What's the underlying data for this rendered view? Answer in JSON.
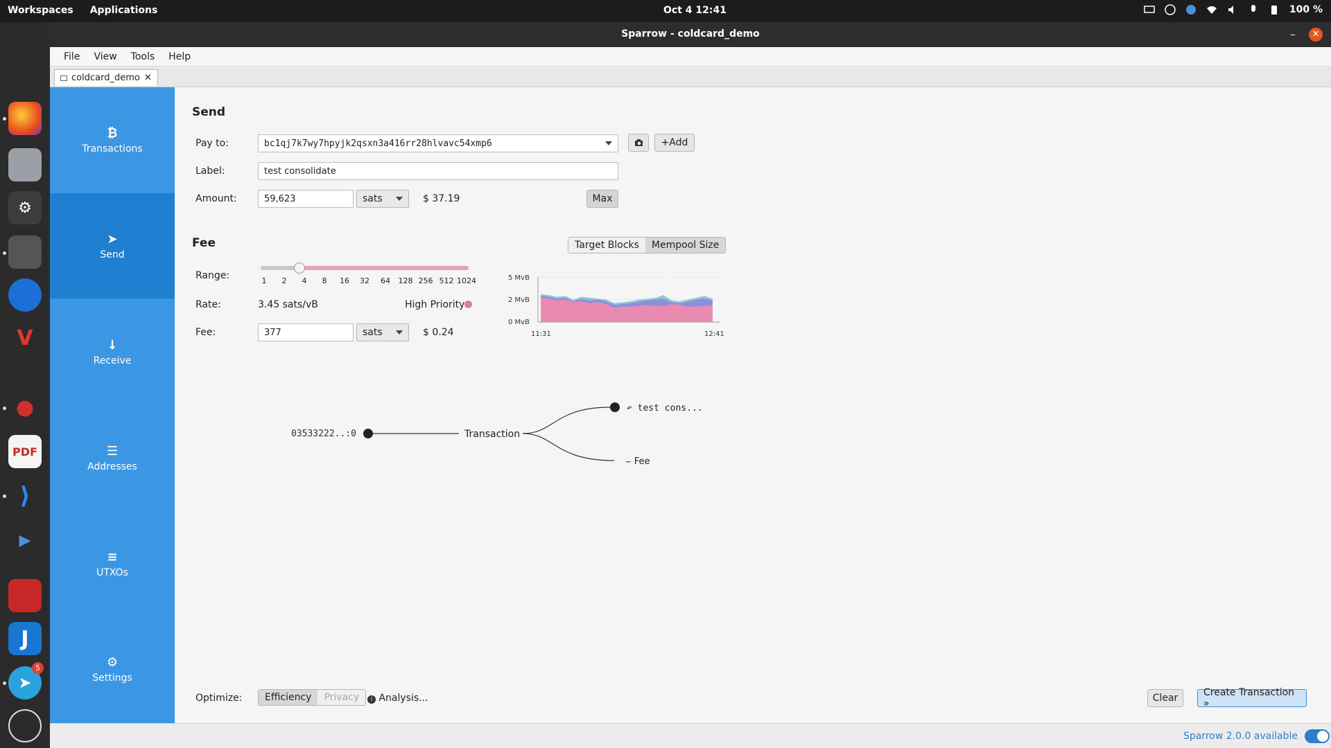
{
  "topbar": {
    "workspaces": "Workspaces",
    "applications": "Applications",
    "clock": "Oct 4  12:41",
    "battery": "100 %"
  },
  "dock": {
    "telegram_badge": "5"
  },
  "window": {
    "title": "Sparrow - coldcard_demo",
    "minimize": "–",
    "close": "✕"
  },
  "menu": [
    "File",
    "View",
    "Tools",
    "Help"
  ],
  "tab": {
    "label": "coldcard_demo",
    "close": "✕"
  },
  "sidebar": {
    "items": [
      {
        "label": "Transactions",
        "icon": "₿"
      },
      {
        "label": "Send",
        "icon": "➤"
      },
      {
        "label": "Receive",
        "icon": "↓"
      },
      {
        "label": "Addresses",
        "icon": "☰"
      },
      {
        "label": "UTXOs",
        "icon": "≡"
      },
      {
        "label": "Settings",
        "icon": "⚙"
      }
    ]
  },
  "send": {
    "title": "Send",
    "pay_to_label": "Pay to:",
    "pay_to_value": "bc1qj7k7wy7hpyjk2qsxn3a416rr28hlvavc54xmp6",
    "camera_icon": "camera-icon",
    "add_label": "+Add",
    "label_label": "Label:",
    "label_value": "test consolidate",
    "amount_label": "Amount:",
    "amount_value": "59,623",
    "amount_unit": "sats",
    "amount_fiat": "$ 37.19",
    "max_label": "Max"
  },
  "fee": {
    "title": "Fee",
    "target_blocks": "Target Blocks",
    "mempool_size": "Mempool Size",
    "range_label": "Range:",
    "range_ticks": [
      "1",
      "2",
      "4",
      "8",
      "16",
      "32",
      "64",
      "128",
      "256",
      "512",
      "1024"
    ],
    "range_position": 0.2,
    "rate_label": "Rate:",
    "rate_value": "3.45 sats/vB",
    "priority": "High Priority",
    "priority_color": "#e07f9a",
    "fee_label": "Fee:",
    "fee_value": "377",
    "fee_unit": "sats",
    "fee_fiat": "$ 0.24"
  },
  "chart_data": {
    "type": "area",
    "title": "",
    "y_ticks": [
      "5 MvB",
      "2 MvB",
      "0 MvB"
    ],
    "x_ticks": [
      "11:31",
      "12:41"
    ],
    "series": [
      {
        "color": "#e98bb0",
        "values": [
          2.7,
          2.6,
          2.4,
          2.5,
          2.2,
          2.3,
          2.1,
          2.2,
          2.0,
          1.6,
          1.7,
          1.7,
          1.8,
          1.9,
          1.8,
          1.8,
          2.0,
          1.9,
          1.7,
          1.7,
          1.8,
          1.9
        ]
      },
      {
        "color": "#8f8fd8",
        "values": [
          2.9,
          2.8,
          2.6,
          2.7,
          2.3,
          2.6,
          2.4,
          2.5,
          2.3,
          1.9,
          2.0,
          2.1,
          2.3,
          2.4,
          2.5,
          2.6,
          2.2,
          2.1,
          2.3,
          2.5,
          2.6,
          2.4
        ]
      },
      {
        "color": "#8fc8d8",
        "values": [
          3.1,
          3.0,
          2.8,
          2.9,
          2.5,
          2.8,
          2.7,
          2.6,
          2.5,
          2.1,
          2.2,
          2.3,
          2.5,
          2.6,
          2.7,
          3.0,
          2.4,
          2.3,
          2.5,
          2.7,
          2.9,
          2.6
        ]
      }
    ],
    "ylim": [
      0,
      5
    ]
  },
  "diagram": {
    "input": "03533222..:0",
    "tx": "Transaction",
    "output": "test cons...",
    "fee": "Fee"
  },
  "optimize": {
    "label": "Optimize:",
    "efficiency": "Efficiency",
    "privacy": "Privacy",
    "analysis": "Analysis..."
  },
  "actions": {
    "clear": "Clear",
    "create": "Create Transaction »"
  },
  "status": {
    "update": "Sparrow 2.0.0 available"
  }
}
